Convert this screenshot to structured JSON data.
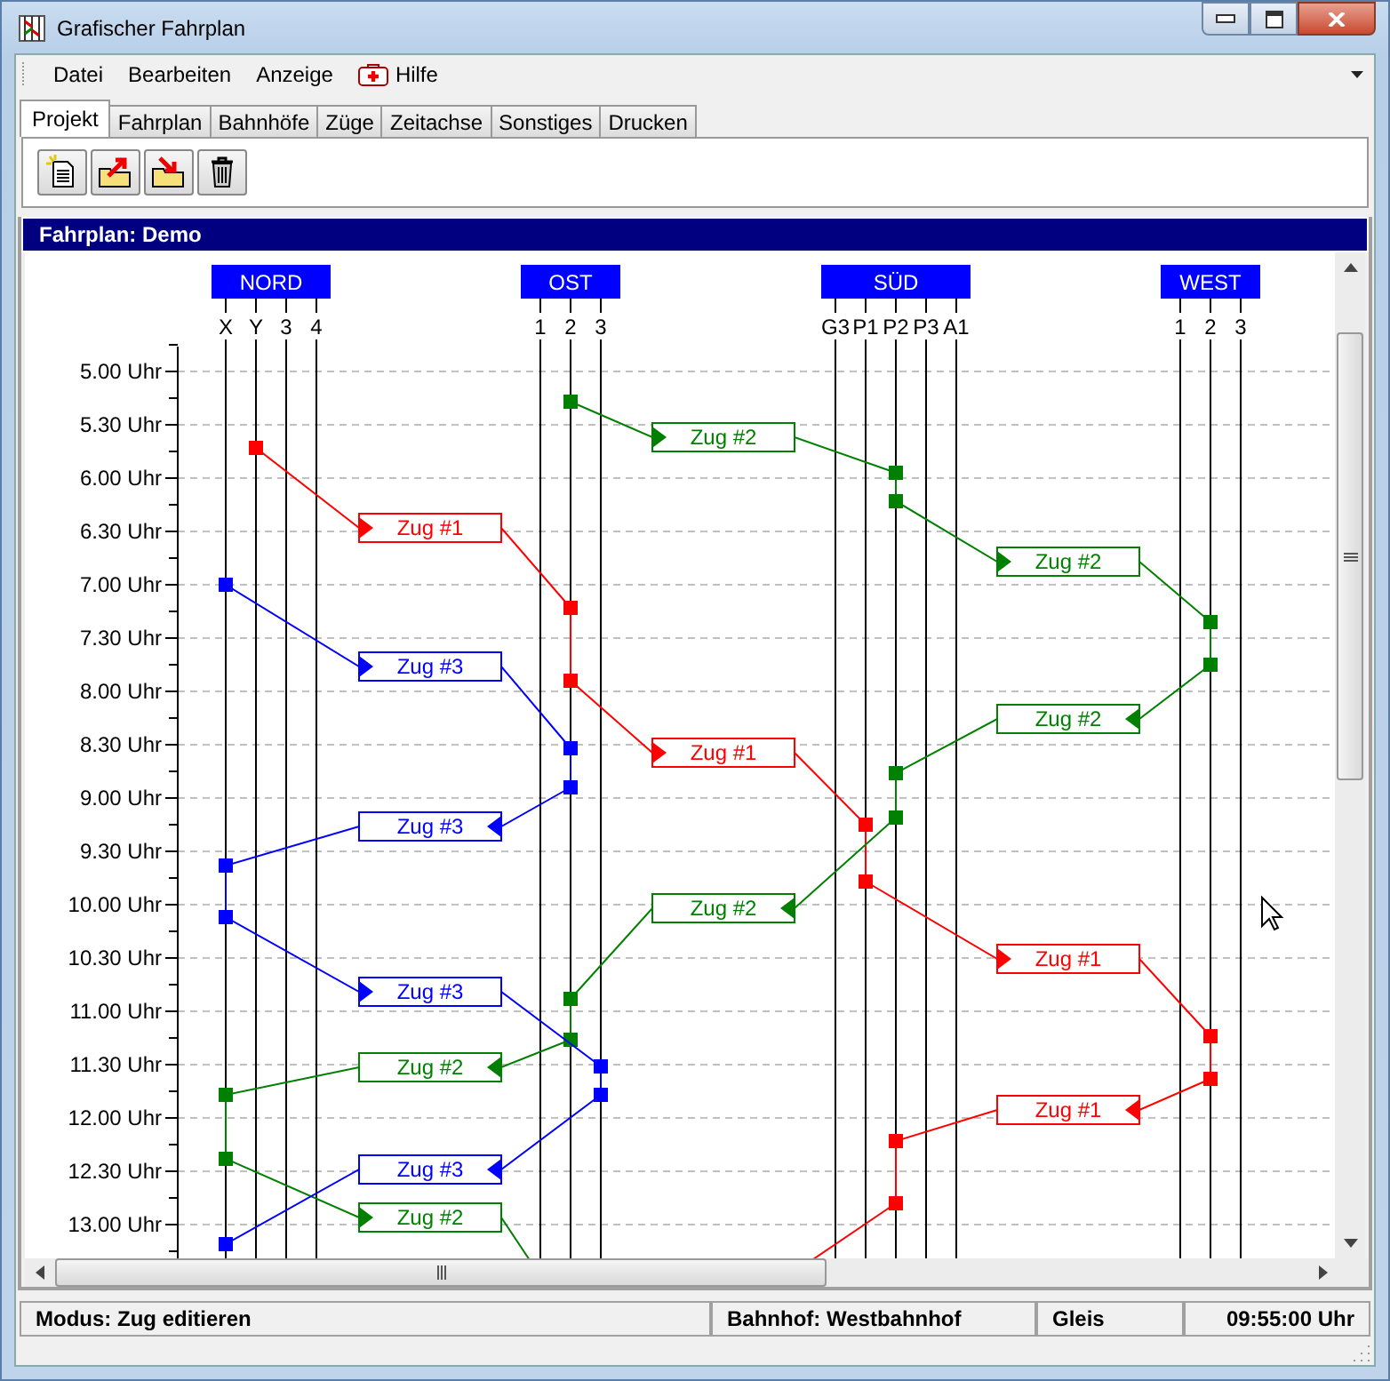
{
  "window": {
    "title": "Grafischer Fahrplan"
  },
  "menu": [
    {
      "label": "Datei",
      "kind": "plain"
    },
    {
      "label": "Bearbeiten",
      "kind": "plain"
    },
    {
      "label": "Anzeige",
      "kind": "plain"
    },
    {
      "label": "Hilfe",
      "kind": "help"
    }
  ],
  "tabs": [
    {
      "label": "Projekt",
      "selected": true
    },
    {
      "label": "Fahrplan",
      "selected": false
    },
    {
      "label": "Bahnhöfe",
      "selected": false
    },
    {
      "label": "Züge",
      "selected": false
    },
    {
      "label": "Zeitachse",
      "selected": false
    },
    {
      "label": "Sonstiges",
      "selected": false
    },
    {
      "label": "Drucken",
      "selected": false
    }
  ],
  "schedule": {
    "title": "Fahrplan: Demo",
    "stations": [
      {
        "name": "NORD",
        "tracks": [
          "X",
          "Y",
          "3",
          "4"
        ]
      },
      {
        "name": "OST",
        "tracks": [
          "1",
          "2",
          "3"
        ]
      },
      {
        "name": "SÜD",
        "tracks": [
          "G3",
          "P1",
          "P2",
          "P3",
          "A1"
        ]
      },
      {
        "name": "WEST",
        "tracks": [
          "1",
          "2",
          "3"
        ]
      }
    ],
    "time_labels": [
      "5.00 Uhr",
      "5.30 Uhr",
      "6.00 Uhr",
      "6.30 Uhr",
      "7.00 Uhr",
      "7.30 Uhr",
      "8.00 Uhr",
      "8.30 Uhr",
      "9.00 Uhr",
      "9.30 Uhr",
      "10.00 Uhr",
      "10.30 Uhr",
      "11.00 Uhr",
      "11.30 Uhr",
      "12.00 Uhr",
      "12.30 Uhr",
      "13.00 Uhr"
    ],
    "trains": [
      {
        "color": "#ff0000",
        "labels": [
          "Zug #1",
          "Zug #1",
          "Zug #1",
          "Zug #1"
        ]
      },
      {
        "color": "#008000",
        "labels": [
          "Zug #2",
          "Zug #2",
          "Zug #2",
          "Zug #2",
          "Zug #2",
          "Zug #2"
        ]
      },
      {
        "color": "#0000ff",
        "labels": [
          "Zug #3",
          "Zug #3",
          "Zug #3",
          "Zug #3"
        ]
      }
    ]
  },
  "status_bar": [
    "Modus: Zug editieren",
    "Bahnhof: Westbahnhof",
    "Gleis",
    "09:55:00 Uhr"
  ]
}
